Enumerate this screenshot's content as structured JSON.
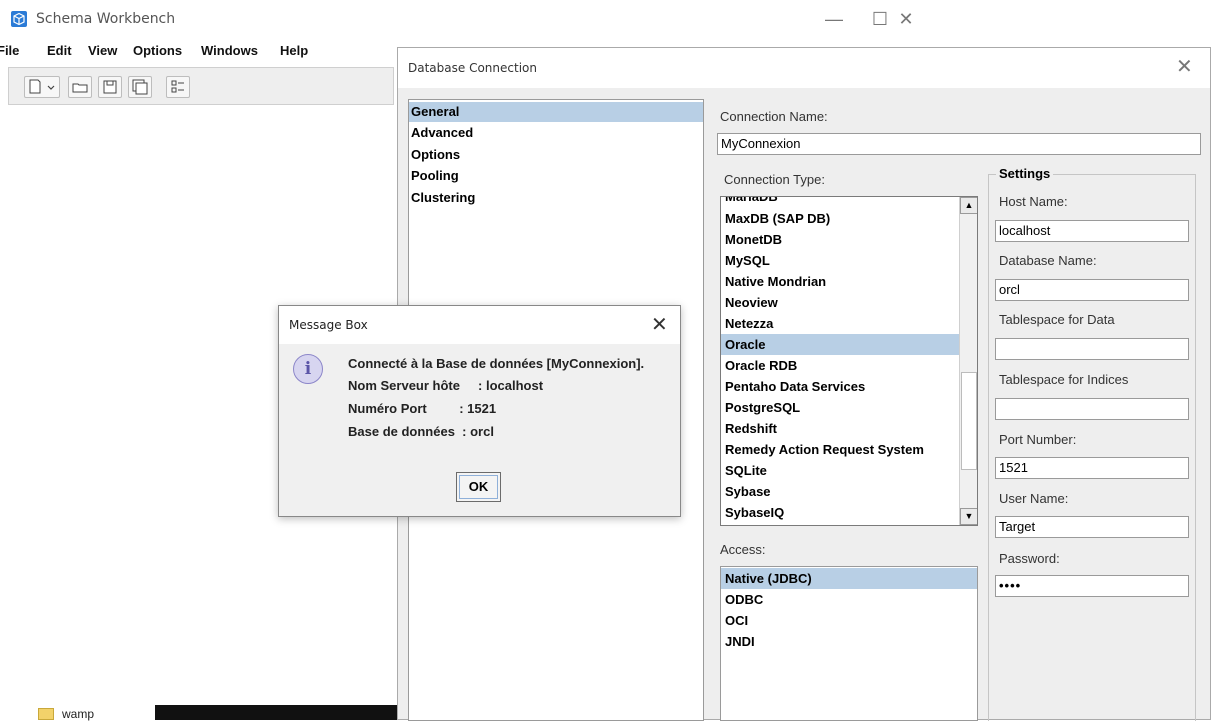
{
  "app": {
    "title": "Schema Workbench",
    "minimize": "—",
    "maximize": "☐",
    "close": "✕"
  },
  "menu": {
    "file": "File",
    "edit": "Edit",
    "view": "View",
    "options": "Options",
    "windows": "Windows",
    "help": "Help"
  },
  "taskbar": {
    "folder_label": "wamp"
  },
  "db_dialog": {
    "title": "Database Connection",
    "close": "✕",
    "nav_items": [
      "General",
      "Advanced",
      "Options",
      "Pooling",
      "Clustering"
    ],
    "connection_name_label": "Connection Name:",
    "connection_name_value": "MyConnexion",
    "connection_type_label": "Connection Type:",
    "connection_types": [
      "MariaDB",
      "MaxDB (SAP DB)",
      "MonetDB",
      "MySQL",
      "Native Mondrian",
      "Neoview",
      "Netezza",
      "Oracle",
      "Oracle RDB",
      "Pentaho Data Services",
      "PostgreSQL",
      "Redshift",
      "Remedy Action Request System",
      "SQLite",
      "Sybase",
      "SybaseIQ"
    ],
    "access_label": "Access:",
    "access_types": [
      "Native (JDBC)",
      "ODBC",
      "OCI",
      "JNDI"
    ],
    "settings_title": "Settings",
    "host_name_label": "Host Name:",
    "host_name_value": "localhost",
    "database_name_label": "Database Name:",
    "database_name_value": "orcl",
    "tablespace_data_label": "Tablespace for Data",
    "tablespace_data_value": "",
    "tablespace_indices_label": "Tablespace for Indices",
    "tablespace_indices_value": "",
    "port_label": "Port Number:",
    "port_value": "1521",
    "user_label": "User Name:",
    "user_value": "Target",
    "password_label": "Password:",
    "password_value": "••••"
  },
  "message_box": {
    "title": "Message Box",
    "close": "✕",
    "icon_glyph": "i",
    "line1": "Connecté à la Base de données [MyConnexion].",
    "line2": "Nom Serveur hôte     : localhost",
    "line3": "Numéro Port         : 1521",
    "line4": "Base de données  : orcl",
    "ok_label": "OK"
  }
}
